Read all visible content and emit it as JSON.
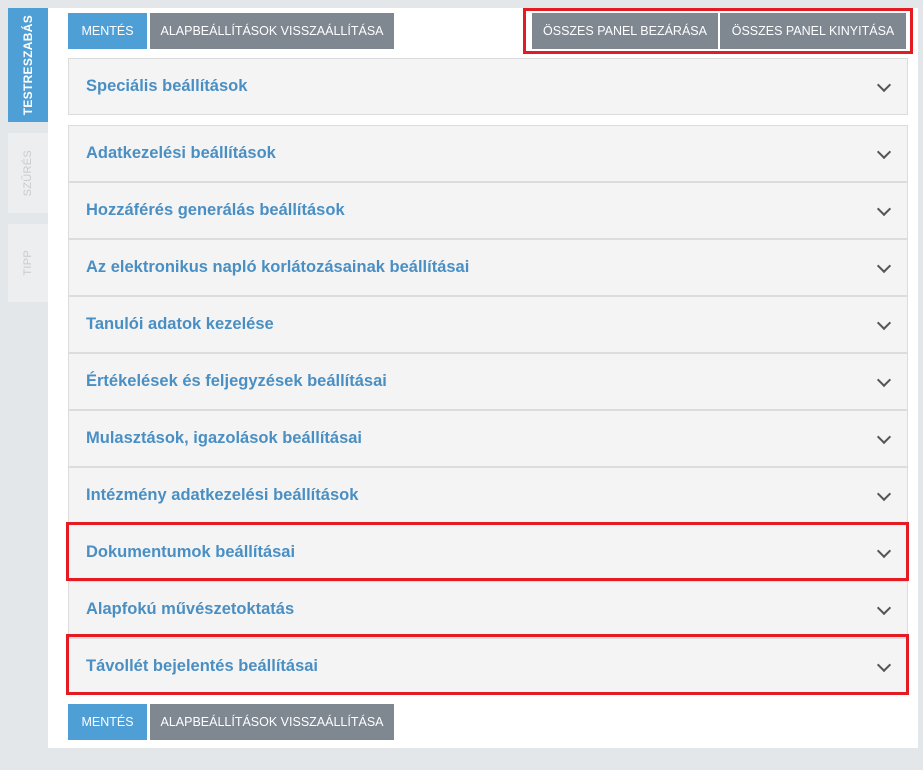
{
  "side_tabs": [
    {
      "label": "Testreszabás",
      "active": true
    },
    {
      "label": "Szűrés",
      "active": false
    },
    {
      "label": "Tipp",
      "active": false
    }
  ],
  "toolbar": {
    "save_label": "Mentés",
    "reset_label": "Alapbeállítások visszaállítása",
    "collapse_all_label": "Összes panel bezárása",
    "expand_all_label": "Összes panel kinyitása"
  },
  "panels": [
    {
      "title": "Speciális beállítások"
    },
    {
      "title": "Adatkezelési beállítások"
    },
    {
      "title": "Hozzáférés generálás beállítások"
    },
    {
      "title": "Az elektronikus napló korlátozásainak beállításai"
    },
    {
      "title": "Tanulói adatok kezelése"
    },
    {
      "title": "Értékelések és feljegyzések beállításai"
    },
    {
      "title": "Mulasztások, igazolások beállításai"
    },
    {
      "title": "Intézmény adatkezelési beállítások"
    },
    {
      "title": "Dokumentumok beállításai",
      "highlighted": true
    },
    {
      "title": "Alapfokú művészetoktatás"
    },
    {
      "title": "Távollét bejelentés beállításai",
      "highlighted": true
    }
  ],
  "colors": {
    "accent": "#4e9fd6",
    "secondary_button": "#7f8791",
    "panel_title": "#4a8fc3",
    "highlight": "#e31b23"
  }
}
